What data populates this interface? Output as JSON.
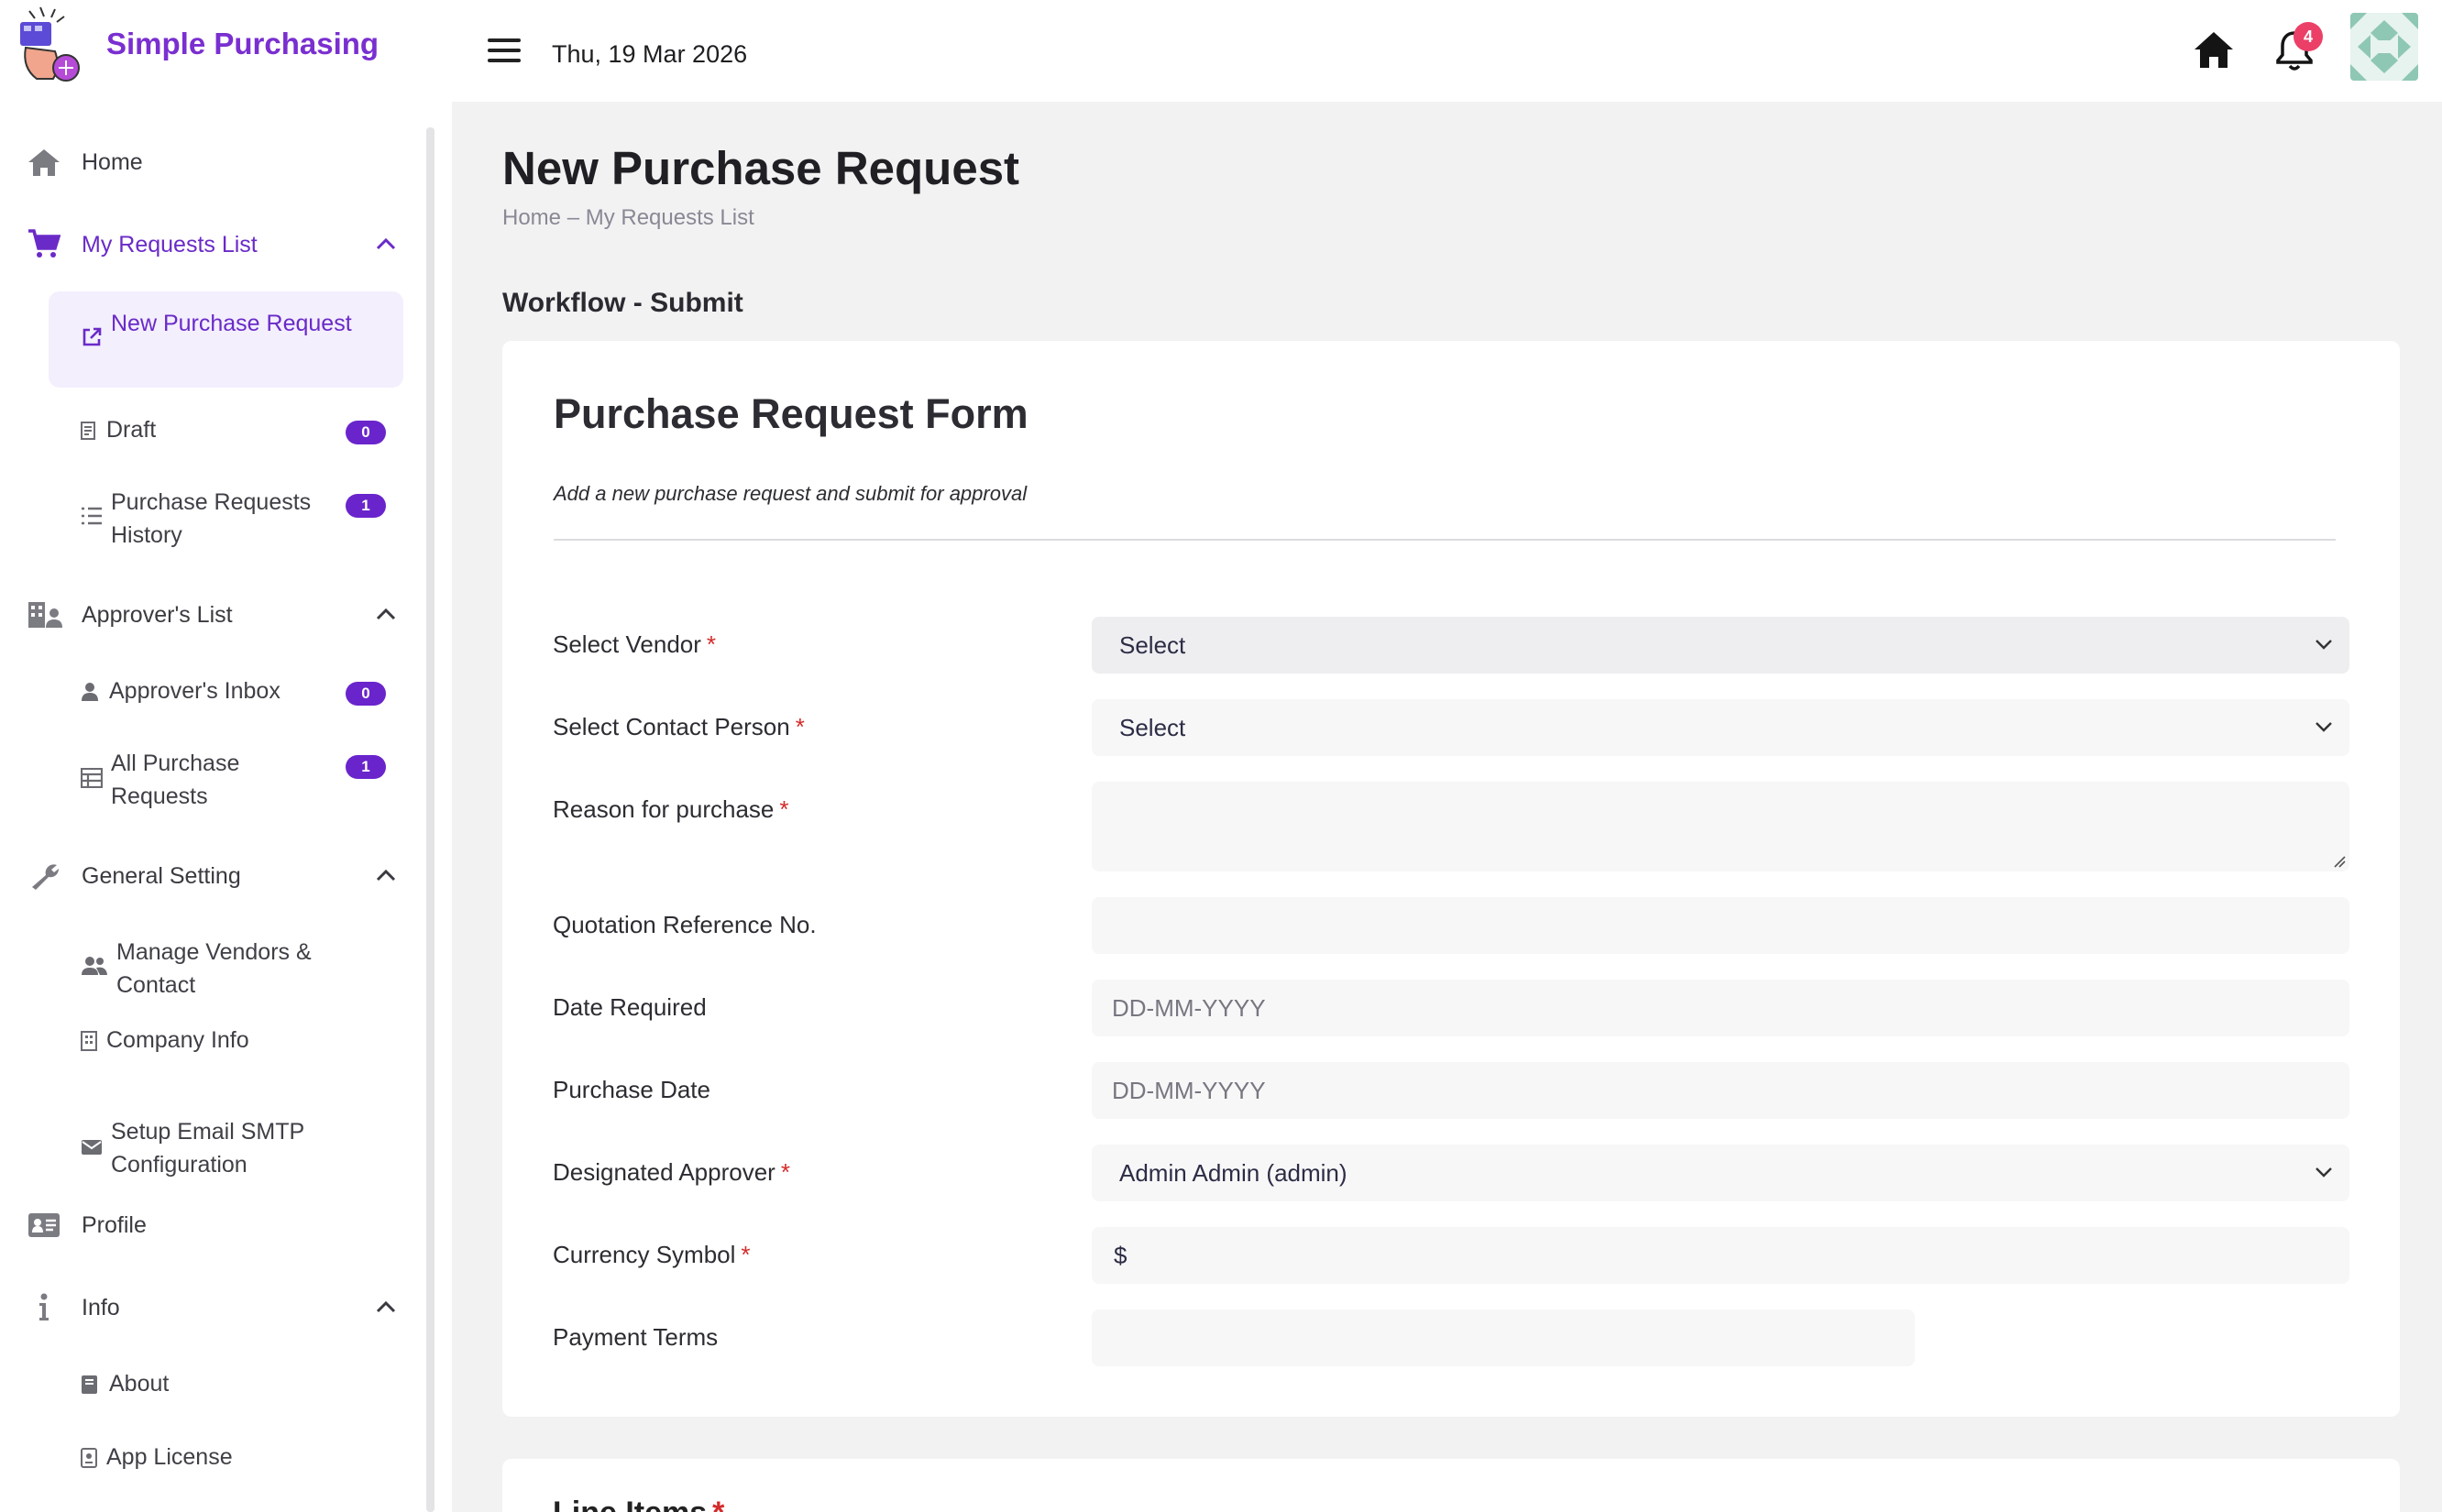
{
  "app": {
    "name": "Simple Purchasing",
    "date": "Thu, 19 Mar 2026"
  },
  "header": {
    "notifications_count": "4"
  },
  "sidebar": {
    "home": "Home",
    "my_requests": "My Requests List",
    "new_purchase_request": "New Purchase Request",
    "draft": "Draft",
    "draft_count": "0",
    "history": "Purchase Requests History",
    "history_count": "1",
    "approvers_list": "Approver's List",
    "approvers_inbox": "Approver's Inbox",
    "inbox_count": "0",
    "all_requests": "All Purchase Requests",
    "all_requests_count": "1",
    "general_setting": "General Setting",
    "manage_vendors": "Manage Vendors & Contact",
    "company_info": "Company Info",
    "smtp": "Setup Email SMTP Configuration",
    "profile": "Profile",
    "info": "Info",
    "about": "About",
    "license": "App License"
  },
  "page": {
    "title": "New Purchase Request",
    "breadcrumb": "Home – My Requests List",
    "section": "Workflow - Submit"
  },
  "form": {
    "title": "Purchase Request Form",
    "subtitle": "Add a new purchase request and submit for approval",
    "vendor_label": "Select Vendor",
    "vendor_value": "Select",
    "contact_label": "Select Contact Person",
    "contact_value": "Select",
    "reason_label": "Reason for purchase",
    "quotation_label": "Quotation Reference No.",
    "date_required_label": "Date Required",
    "date_required_placeholder": "DD-MM-YYYY",
    "purchase_date_label": "Purchase Date",
    "purchase_date_placeholder": "DD-MM-YYYY",
    "approver_label": "Designated Approver",
    "approver_value": "Admin Admin (admin)",
    "currency_label": "Currency Symbol",
    "currency_value": "$",
    "payment_terms_label": "Payment Terms",
    "required_mark": "*"
  },
  "line_items": {
    "title": "Line Items"
  }
}
